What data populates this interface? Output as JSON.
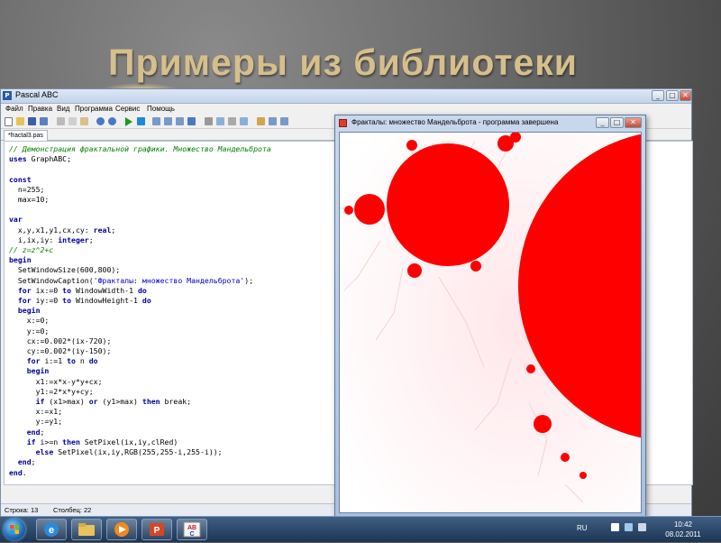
{
  "slide": {
    "title": "Примеры из библиотеки"
  },
  "ide": {
    "title": "Pascal ABC",
    "menu": [
      "Файл",
      "Правка",
      "Вид",
      "Программа",
      "Сервис",
      "Помощь"
    ],
    "tab": "*fractal3.pas",
    "code_lines": [
      "// Демонстрация фрактальной графики. Множество Мандельброта",
      "uses GraphABC;",
      "",
      "const",
      "  n=255;",
      "  max=10;",
      "",
      "var",
      "  x,y,x1,y1,cx,cy: real;",
      "  i,ix,iy: integer;",
      "// z=z^2+c",
      "begin",
      "  SetWindowSize(600,800);",
      "  SetWindowCaption('Фракталы: множество Мандельброта');",
      "  for ix:=0 to WindowWidth-1 do",
      "  for iy:=0 to WindowHeight-1 do",
      "  begin",
      "    x:=0;",
      "    y:=0;",
      "    cx:=0.002*(ix-720);",
      "    cy:=0.002*(iy-150);",
      "    for i:=1 to n do",
      "    begin",
      "      x1:=x*x-y*y+cx;",
      "      y1:=2*x*y+cy;",
      "      if (x1>max) or (y1>max) then break;",
      "      x:=x1;",
      "      y:=y1;",
      "    end;",
      "    if i>=n then SetPixel(ix,iy,clRed)",
      "      else SetPixel(ix,iy,RGB(255,255-i,255-i));",
      "  end;",
      "end."
    ],
    "status": {
      "line": "Строка: 13",
      "column": "Столбец: 22"
    }
  },
  "fractal": {
    "title": "Фракталы: множество Мандельброта - программа завершена",
    "fill_color": "#ff0000"
  },
  "taskbar": {
    "apps": [
      "windows-explorer",
      "internet-explorer",
      "media-player",
      "powerpoint",
      "pascal-abc"
    ],
    "language": "RU",
    "time": "10:42",
    "date": "08.02.2011"
  }
}
